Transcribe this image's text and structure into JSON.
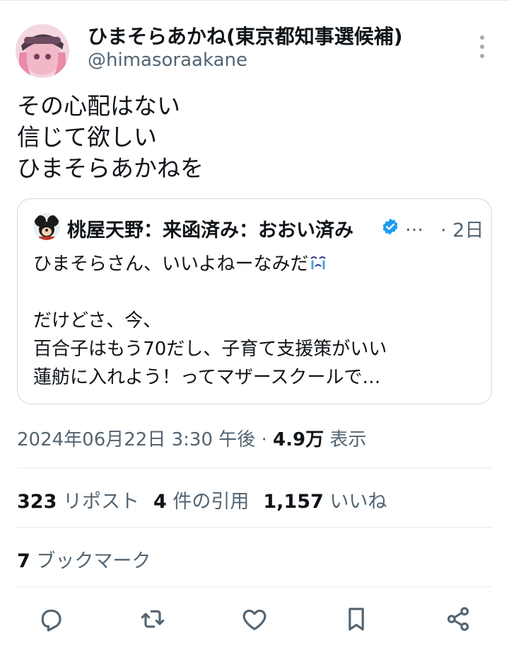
{
  "author": {
    "display_name": "ひまそらあかね(東京都知事選候補)",
    "handle": "@himasoraakane",
    "avatar_icon": "anime-character-avatar"
  },
  "tweet": {
    "lines": [
      "その心配はない",
      "信じて欲しい",
      "ひまそらあかねを"
    ]
  },
  "quote": {
    "display_name": "桃屋天野：来函済み：おおい済み",
    "ellipsis": "…",
    "time": "· 2日",
    "verified_icon": "verified-badge-icon",
    "lines": [
      "ひまそらさん、いいよねーなみだ",
      "",
      "だけどさ、今、",
      "百合子はもう70だし、子育て支援策がいい",
      "蓮舫に入れよう！ってマザースクールで…"
    ]
  },
  "meta": {
    "datetime": "2024年06月22日 3:30 午後 · ",
    "views_count": "4.9万",
    "views_label": " 表示"
  },
  "stats": {
    "reposts_count": "323",
    "reposts_label": " リポスト",
    "quotes_count": "4",
    "quotes_label": " 件の引用",
    "likes_count": "1,157",
    "likes_label": " いいね"
  },
  "bookmarks": {
    "count": "7",
    "label": " ブックマーク"
  },
  "colors": {
    "text": "#0f1419",
    "secondary": "#536471",
    "verified": "#1d9bf0",
    "border": "#cfd9de"
  }
}
